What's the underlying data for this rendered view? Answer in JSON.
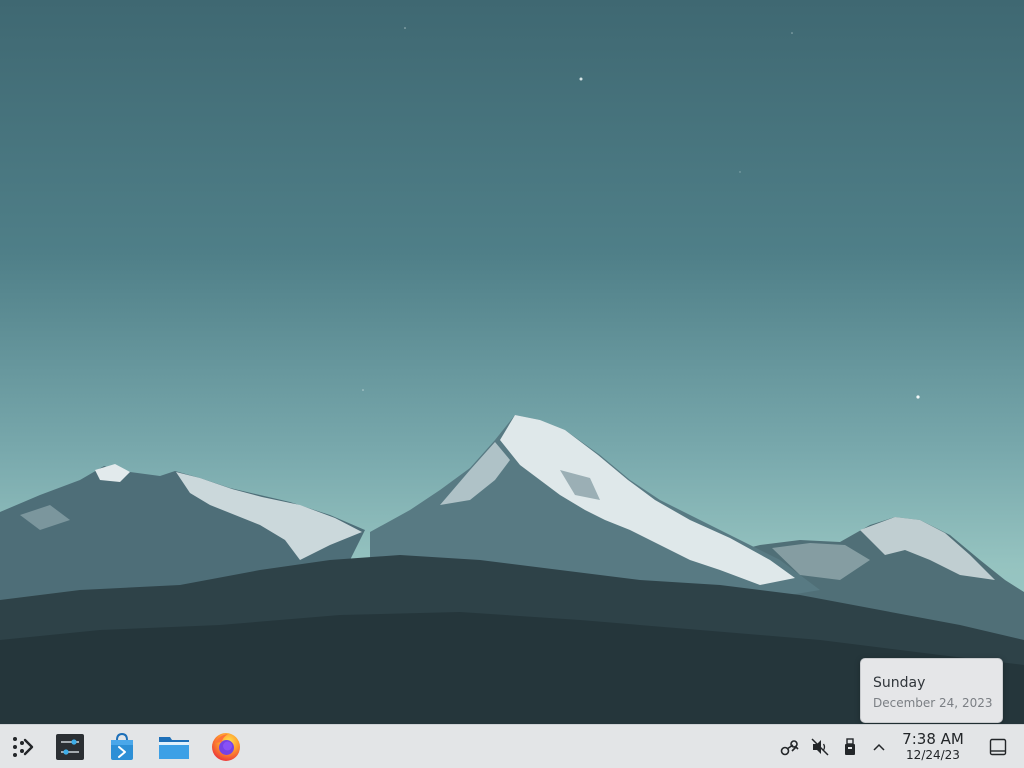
{
  "taskbar": {
    "launcher": {
      "icon": "application-launcher-icon"
    },
    "pinned_apps": [
      {
        "name": "System Settings",
        "icon": "settings-sliders-icon"
      },
      {
        "name": "Discover",
        "icon": "store-bag-icon"
      },
      {
        "name": "Dolphin",
        "icon": "folder-icon"
      },
      {
        "name": "Firefox",
        "icon": "firefox-icon"
      }
    ],
    "tray": {
      "icons": [
        "steam-icon",
        "volume-muted-icon",
        "usb-drive-icon",
        "chevron-up-icon"
      ]
    },
    "clock": {
      "time": "7:38 AM",
      "date": "12/24/23"
    },
    "show_desktop": {
      "icon": "show-desktop-icon"
    }
  },
  "clock_tooltip": {
    "day": "Sunday",
    "full_date": "December 24, 2023"
  },
  "colors": {
    "panel_bg": "#e3e5e7",
    "sky_top": "#3f6872",
    "sky_bottom": "#a4cfca",
    "firefox_orange": "#ff7139",
    "firefox_purple": "#7542e5",
    "folder_blue": "#2d8fd6"
  }
}
